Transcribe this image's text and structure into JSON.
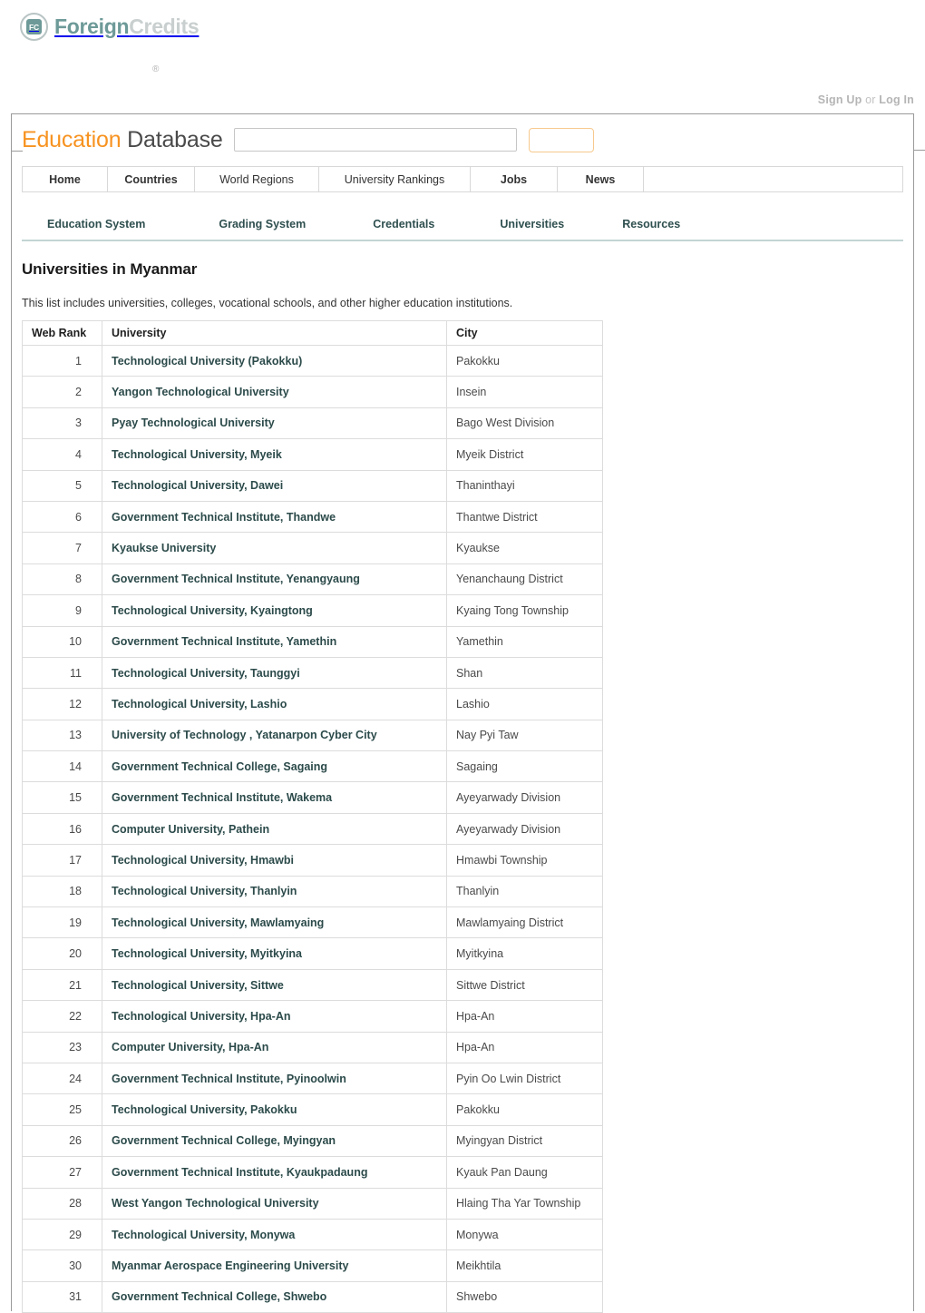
{
  "brand": {
    "mark_text": "FC",
    "name_primary": "Foreign",
    "name_secondary": "Credits",
    "registered_mark": "®"
  },
  "auth": {
    "sign_up": "Sign Up",
    "separator": "or",
    "log_in": "Log In"
  },
  "site_title": {
    "word1": "Education",
    "word2": "Database"
  },
  "search": {
    "value": "",
    "placeholder": "",
    "button_label": ""
  },
  "main_nav": [
    {
      "label": "Home"
    },
    {
      "label": "Countries"
    },
    {
      "label": "World Regions"
    },
    {
      "label": "University Rankings"
    },
    {
      "label": "Jobs"
    },
    {
      "label": "News"
    }
  ],
  "sub_nav": [
    {
      "label": "Education System"
    },
    {
      "label": "Grading System"
    },
    {
      "label": "Credentials"
    },
    {
      "label": "Universities"
    },
    {
      "label": "Resources"
    }
  ],
  "page": {
    "heading": "Universities in Myanmar",
    "intro": "This list includes universities, colleges, vocational schools, and other higher education institutions."
  },
  "table": {
    "columns": [
      "Web Rank",
      "University",
      "City"
    ],
    "rows": [
      {
        "rank": "1",
        "university": "Technological University (Pakokku)",
        "city": "Pakokku"
      },
      {
        "rank": "2",
        "university": "Yangon Technological University",
        "city": "Insein"
      },
      {
        "rank": "3",
        "university": "Pyay Technological University",
        "city": "Bago West Division"
      },
      {
        "rank": "4",
        "university": "Technological University, Myeik",
        "city": "Myeik District"
      },
      {
        "rank": "5",
        "university": "Technological University, Dawei",
        "city": "Thaninthayi"
      },
      {
        "rank": "6",
        "university": "Government Technical Institute, Thandwe",
        "city": "Thantwe District"
      },
      {
        "rank": "7",
        "university": "Kyaukse University",
        "city": "Kyaukse"
      },
      {
        "rank": "8",
        "university": "Government Technical Institute, Yenangyaung",
        "city": "Yenanchaung District"
      },
      {
        "rank": "9",
        "university": "Technological University, Kyaingtong",
        "city": "Kyaing Tong Township"
      },
      {
        "rank": "10",
        "university": "Government Technical Institute, Yamethin",
        "city": "Yamethin"
      },
      {
        "rank": "11",
        "university": "Technological University, Taunggyi",
        "city": "Shan"
      },
      {
        "rank": "12",
        "university": "Technological University, Lashio",
        "city": "Lashio"
      },
      {
        "rank": "13",
        "university": "University of Technology , Yatanarpon Cyber City",
        "city": "Nay Pyi Taw"
      },
      {
        "rank": "14",
        "university": "Government Technical College, Sagaing",
        "city": "Sagaing"
      },
      {
        "rank": "15",
        "university": "Government Technical Institute, Wakema",
        "city": "Ayeyarwady Division"
      },
      {
        "rank": "16",
        "university": "Computer University, Pathein",
        "city": "Ayeyarwady Division"
      },
      {
        "rank": "17",
        "university": "Technological University, Hmawbi",
        "city": "Hmawbi Township"
      },
      {
        "rank": "18",
        "university": "Technological University, Thanlyin",
        "city": "Thanlyin"
      },
      {
        "rank": "19",
        "university": "Technological University, Mawlamyaing",
        "city": "Mawlamyaing District"
      },
      {
        "rank": "20",
        "university": "Technological University, Myitkyina",
        "city": "Myitkyina"
      },
      {
        "rank": "21",
        "university": "Technological University, Sittwe",
        "city": "Sittwe District"
      },
      {
        "rank": "22",
        "university": "Technological University, Hpa-An",
        "city": "Hpa-An"
      },
      {
        "rank": "23",
        "university": "Computer University, Hpa-An",
        "city": "Hpa-An"
      },
      {
        "rank": "24",
        "university": "Government Technical Institute, Pyinoolwin",
        "city": "Pyin Oo Lwin District"
      },
      {
        "rank": "25",
        "university": "Technological University, Pakokku",
        "city": "Pakokku"
      },
      {
        "rank": "26",
        "university": "Government Technical College, Myingyan",
        "city": "Myingyan District"
      },
      {
        "rank": "27",
        "university": "Government Technical Institute, Kyaukpadaung",
        "city": "Kyauk Pan Daung"
      },
      {
        "rank": "28",
        "university": "West Yangon Technological University",
        "city": "Hlaing Tha Yar Township"
      },
      {
        "rank": "29",
        "university": "Technological University, Monywa",
        "city": "Monywa"
      },
      {
        "rank": "30",
        "university": "Myanmar Aerospace Engineering University",
        "city": "Meikhtila"
      },
      {
        "rank": "31",
        "university": "Government Technical College, Shwebo",
        "city": "Shwebo"
      }
    ]
  },
  "colors": {
    "brand_teal": "#6d9a98",
    "accent_orange": "#f79321",
    "link_dark": "#2c4a4a",
    "rule_teal": "#c3d4d4"
  }
}
